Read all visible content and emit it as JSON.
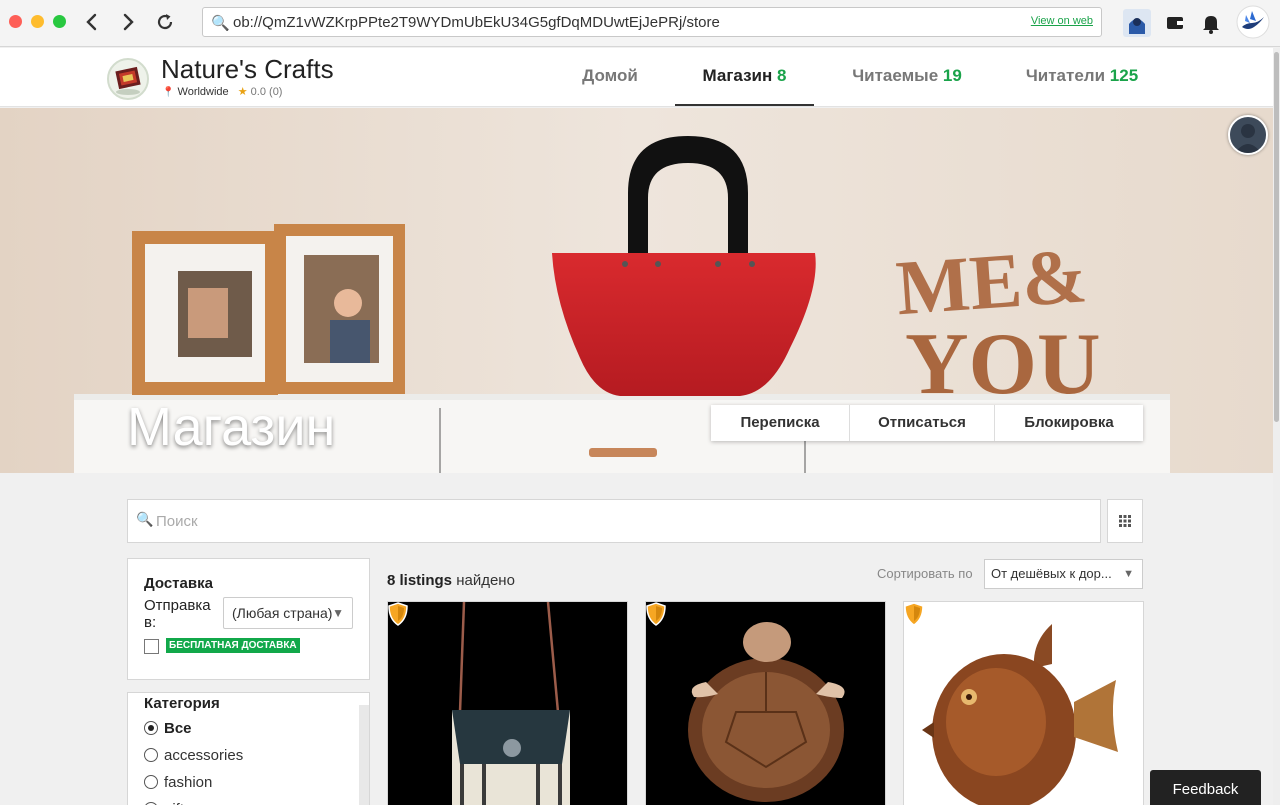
{
  "browser": {
    "url": "ob://QmZ1vWZKrpPPte2T9WYDmUbEkU34G5gfDqMDUwtEjJePRj/store",
    "view_on_web": "View on web"
  },
  "store": {
    "name": "Nature's Crafts",
    "location": "Worldwide",
    "rating": "0.0",
    "rating_count": "(0)"
  },
  "tabs": [
    {
      "label": "Домой",
      "count": ""
    },
    {
      "label": "Магазин",
      "count": "8"
    },
    {
      "label": "Читаемые",
      "count": "19"
    },
    {
      "label": "Читатели",
      "count": "125"
    }
  ],
  "banner": {
    "title": "Магазин",
    "buttons": [
      "Переписка",
      "Отписаться",
      "Блокировка"
    ]
  },
  "search": {
    "placeholder": "Поиск"
  },
  "shipping": {
    "title": "Доставка",
    "ship_to_label": "Отправка в:",
    "country": "(Любая страна)",
    "free_shipping": "БЕСПЛАТНАЯ ДОСТАВКА"
  },
  "category": {
    "title": "Категория",
    "options": [
      "Все",
      "accessories",
      "fashion",
      "gifts"
    ],
    "selected": "Все"
  },
  "listings": {
    "count_bold": "8 listings",
    "count_suffix": "найдено",
    "sort_label": "Сортировать по",
    "sort_value": "От дешёвых к дор..."
  },
  "feedback": "Feedback",
  "colors": {
    "accent_green": "#1aa34a",
    "free_badge": "#11a84a"
  }
}
